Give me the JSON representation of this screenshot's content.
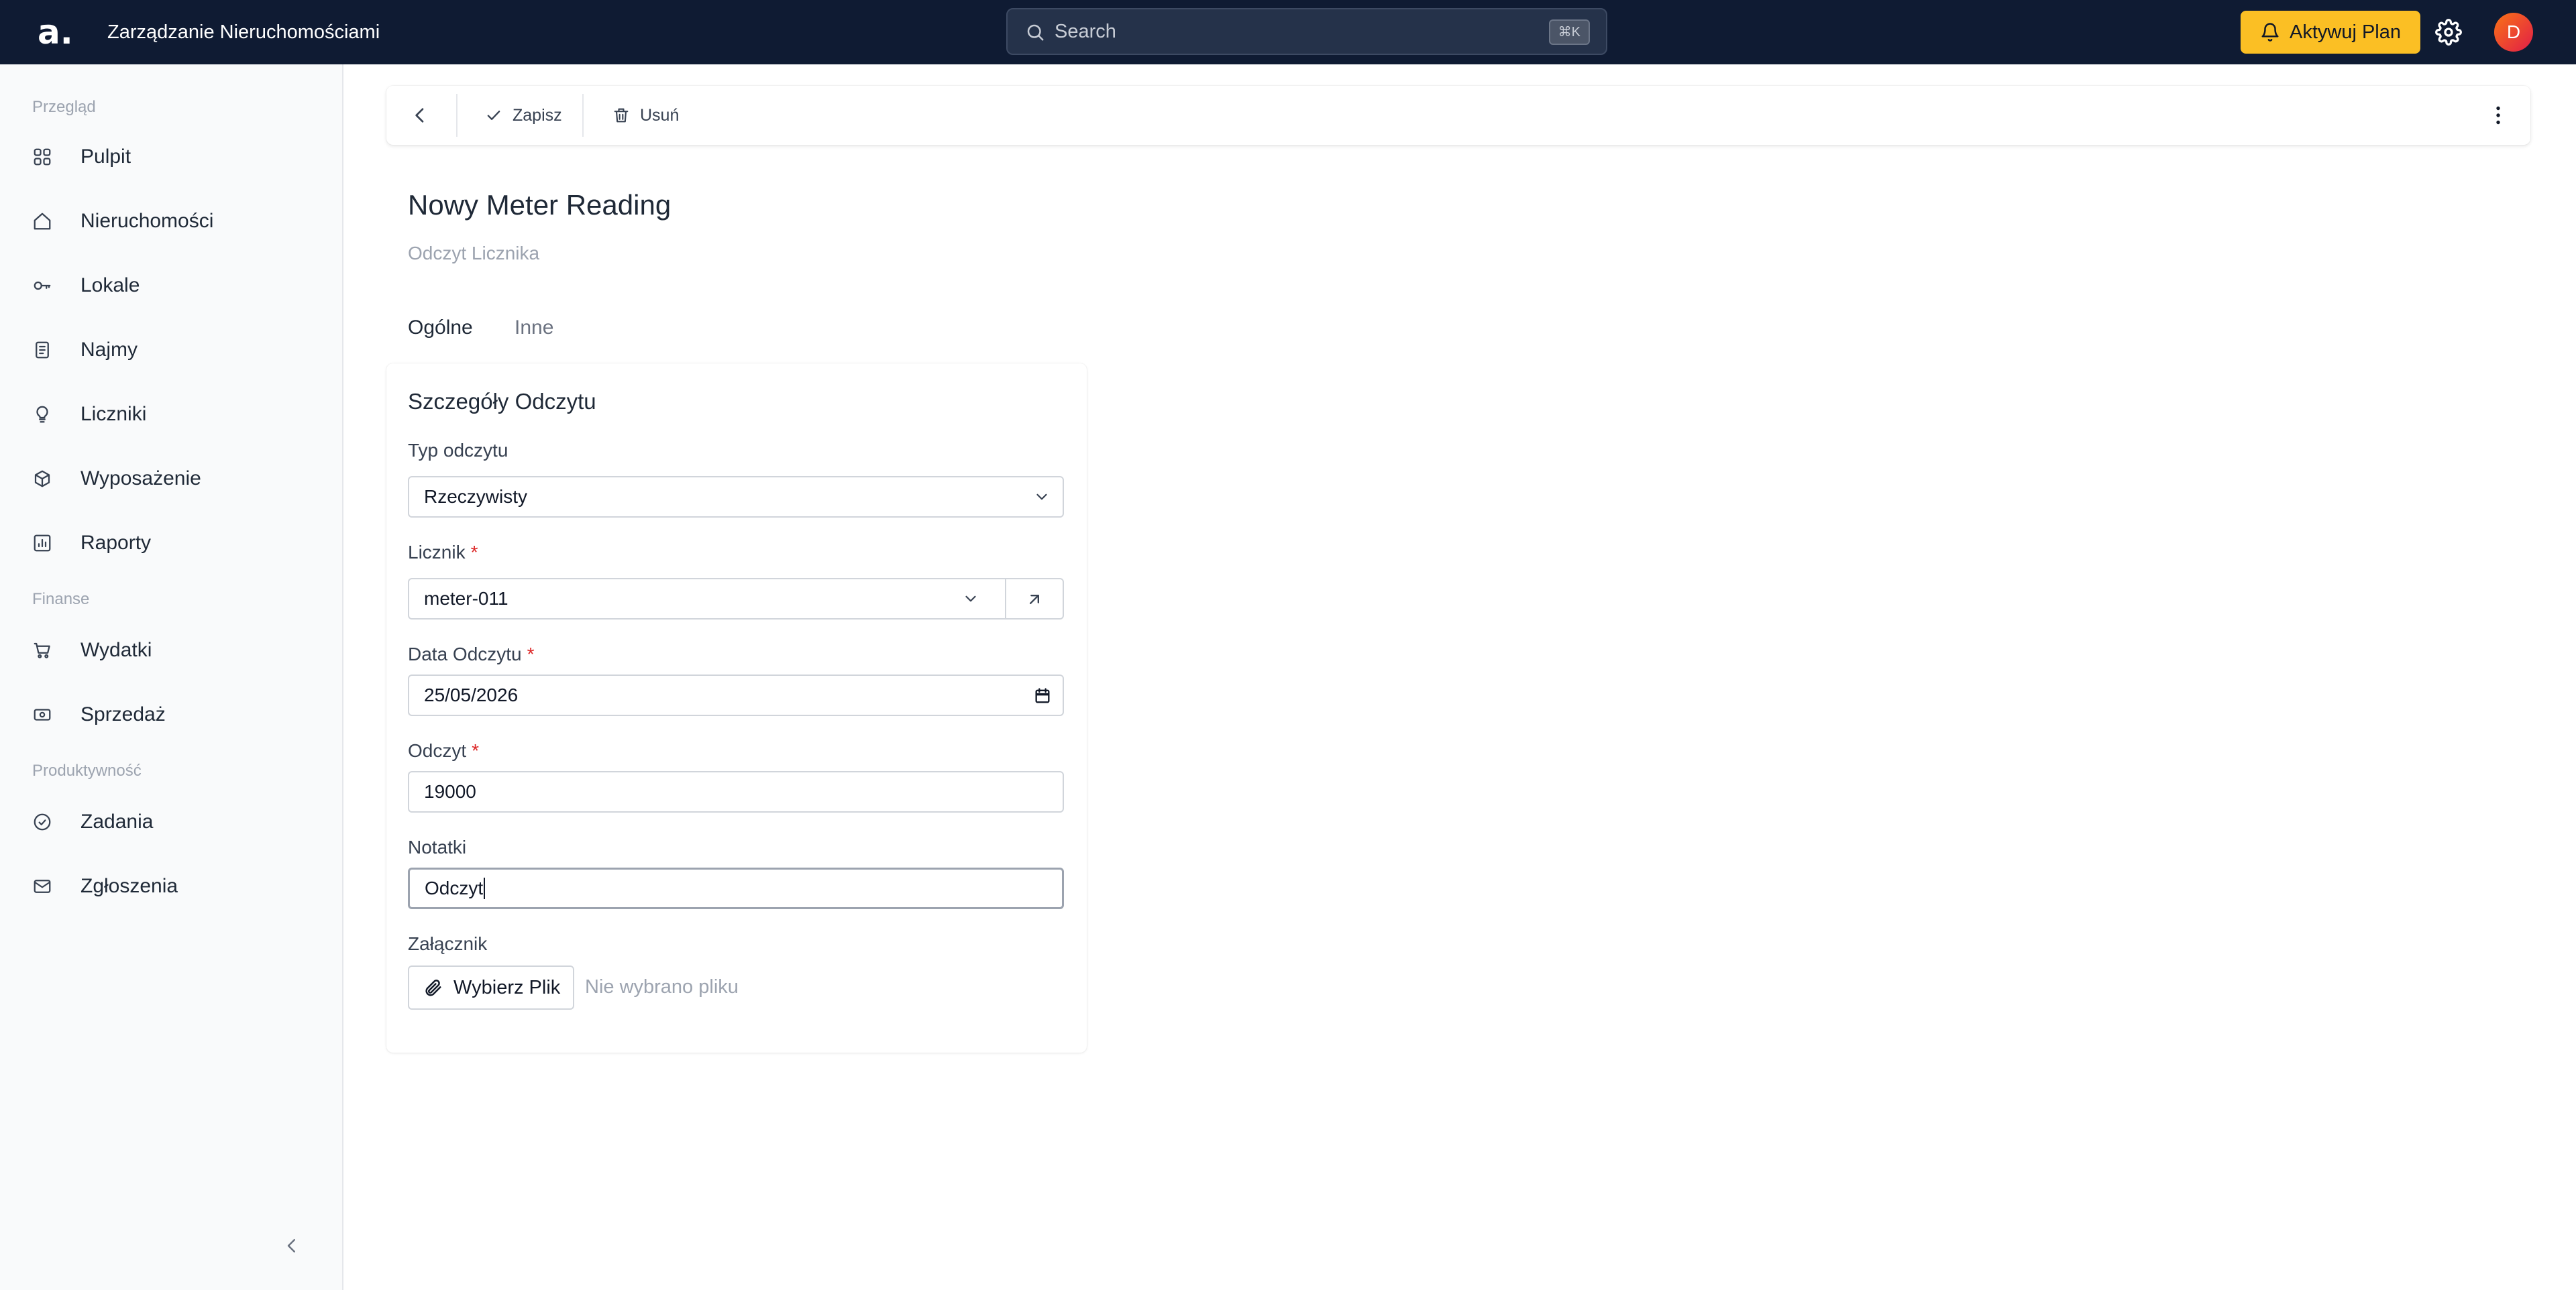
{
  "app": {
    "logo": "a.",
    "title": "Zarządzanie Nieruchomościami"
  },
  "search": {
    "placeholder": "Search",
    "shortcut": "⌘K"
  },
  "header": {
    "activate_label": "Aktywuj Plan",
    "avatar_initial": "D"
  },
  "sidebar": {
    "sections": [
      {
        "label": "Przegląd"
      },
      {
        "label": "Finanse"
      },
      {
        "label": "Produktywność"
      }
    ],
    "items": [
      {
        "label": "Pulpit",
        "icon": "grid-icon"
      },
      {
        "label": "Nieruchomości",
        "icon": "home-icon"
      },
      {
        "label": "Lokale",
        "icon": "key-icon"
      },
      {
        "label": "Najmy",
        "icon": "document-icon"
      },
      {
        "label": "Liczniki",
        "icon": "bulb-icon"
      },
      {
        "label": "Wyposażenie",
        "icon": "box-icon"
      },
      {
        "label": "Raporty",
        "icon": "chart-icon"
      },
      {
        "label": "Wydatki",
        "icon": "cart-icon"
      },
      {
        "label": "Sprzedaż",
        "icon": "cash-icon"
      },
      {
        "label": "Zadania",
        "icon": "check-circle-icon"
      },
      {
        "label": "Zgłoszenia",
        "icon": "mail-icon"
      }
    ]
  },
  "toolbar": {
    "save_label": "Zapisz",
    "delete_label": "Usuń"
  },
  "page": {
    "title": "Nowy Meter Reading",
    "subtitle": "Odczyt Licznika"
  },
  "tabs": [
    {
      "label": "Ogólne",
      "active": true
    },
    {
      "label": "Inne",
      "active": false
    }
  ],
  "form": {
    "card_title": "Szczegóły Odczytu",
    "reading_type": {
      "label": "Typ odczytu",
      "value": "Rzeczywisty"
    },
    "meter": {
      "label": "Licznik",
      "required": "*",
      "value": "meter-011"
    },
    "date": {
      "label": "Data Odczytu",
      "required": "*",
      "value": "25/05/2026"
    },
    "reading": {
      "label": "Odczyt",
      "required": "*",
      "value": "19000"
    },
    "notes": {
      "label": "Notatki",
      "value": "Odczyt"
    },
    "attachment": {
      "label": "Załącznik",
      "button_label": "Wybierz Plik",
      "status": "Nie wybrano pliku"
    }
  },
  "colors": {
    "topbar": "#0f1b33",
    "accent": "#fbbf24",
    "required": "#dc2626"
  }
}
